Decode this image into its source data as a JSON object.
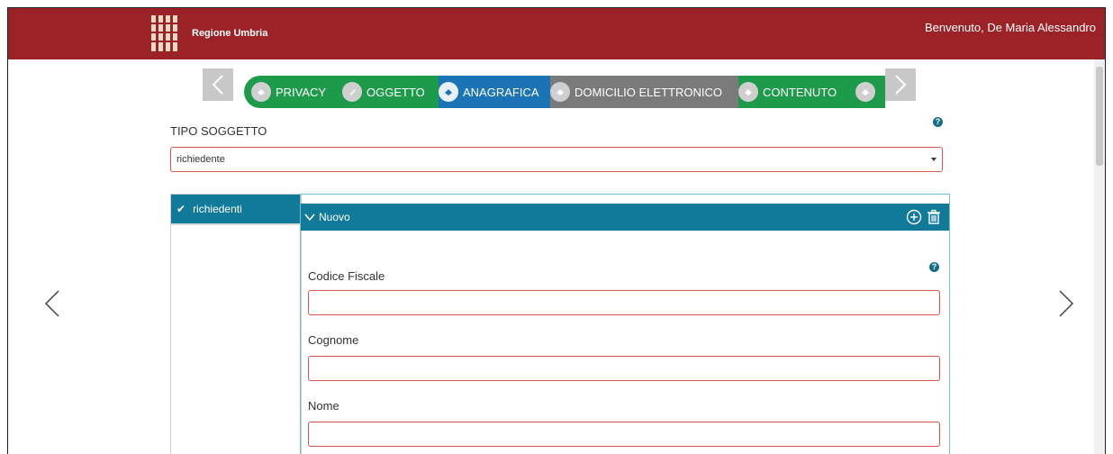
{
  "header": {
    "brand": "Regione Umbria",
    "welcome": "Benvenuto, De Maria Alessandro",
    "colors": {
      "bar": "#9b2227"
    }
  },
  "steps": [
    {
      "label": "PRIVACY",
      "state": "done",
      "color": "#1d9b4b",
      "icon": "fill-icon"
    },
    {
      "label": "OGGETTO",
      "state": "done",
      "color": "#1d9b4b",
      "icon": "pencil-icon"
    },
    {
      "label": "ANAGRAFICA",
      "state": "active",
      "color": "#1b74b5",
      "icon": "fill-icon"
    },
    {
      "label": "DOMICILIO ELETTRONICO",
      "state": "pending",
      "color": "#7a7a7a",
      "icon": "fill-icon"
    },
    {
      "label": "CONTENUTO",
      "state": "done",
      "color": "#1d9b4b",
      "icon": "fill-icon"
    }
  ],
  "form": {
    "tipo_soggetto_label": "TIPO SOGGETTO",
    "tipo_soggetto_value": "richiedente",
    "help_glyph": "?"
  },
  "tabs": {
    "active": {
      "check": "✔",
      "label": "richiedenti"
    }
  },
  "panel": {
    "title": "Nuovo",
    "fields": [
      {
        "label": "Codice Fiscale",
        "value": ""
      },
      {
        "label": "Cognome",
        "value": ""
      },
      {
        "label": "Nome",
        "value": ""
      }
    ]
  },
  "theme": {
    "accent": "#117a9a",
    "error_border": "#d9534f"
  }
}
